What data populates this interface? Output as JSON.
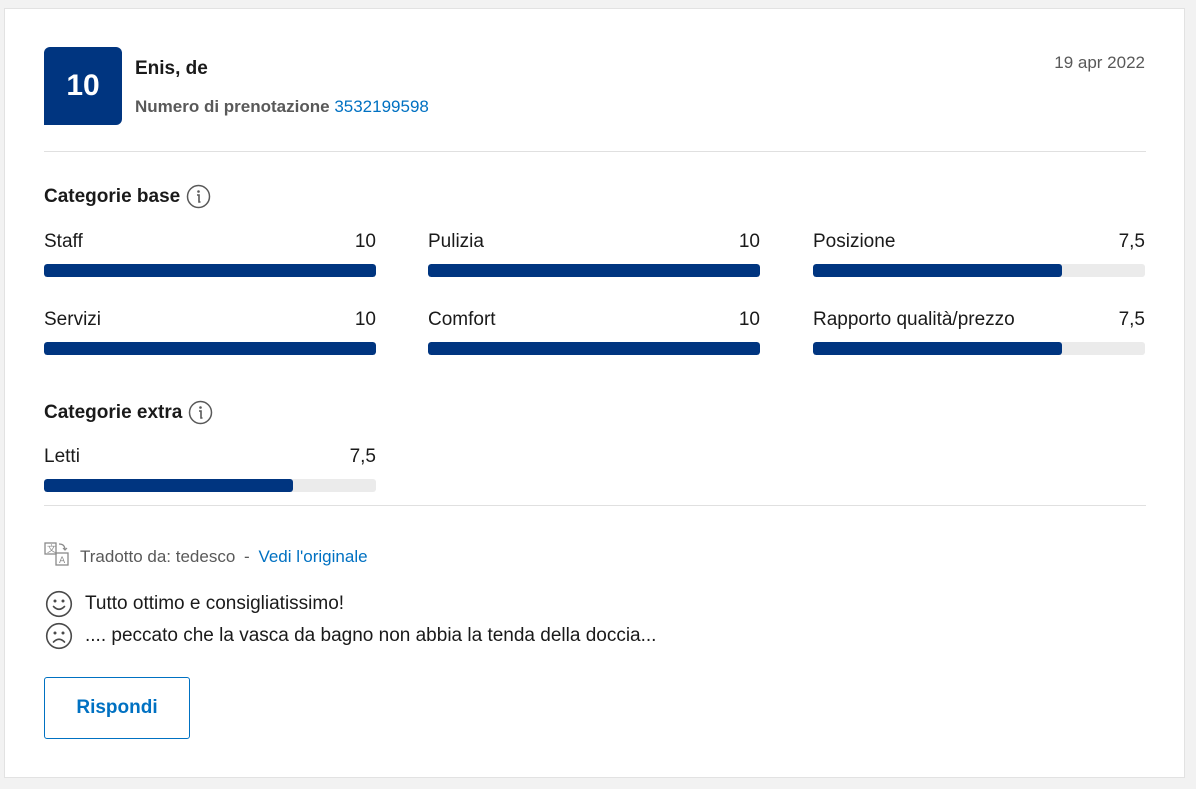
{
  "review": {
    "score": "10",
    "reviewer": "Enis, de",
    "booking_label": "Numero di prenotazione",
    "booking_number": "3532199598",
    "date": "19 apr 2022"
  },
  "base_categories": {
    "title": "Categorie base",
    "items": [
      {
        "label": "Staff",
        "score": "10",
        "fraction": 1.0
      },
      {
        "label": "Pulizia",
        "score": "10",
        "fraction": 1.0
      },
      {
        "label": "Posizione",
        "score": "7,5",
        "fraction": 0.75
      },
      {
        "label": "Servizi",
        "score": "10",
        "fraction": 1.0
      },
      {
        "label": "Comfort",
        "score": "10",
        "fraction": 1.0
      },
      {
        "label": "Rapporto qualità/prezzo",
        "score": "7,5",
        "fraction": 0.75
      }
    ]
  },
  "extra_categories": {
    "title": "Categorie extra",
    "items": [
      {
        "label": "Letti",
        "score": "7,5",
        "fraction": 0.75
      }
    ]
  },
  "translation": {
    "text": "Tradotto da: tedesco",
    "separator": "-",
    "link": "Vedi l'originale"
  },
  "comments": {
    "positive": "Tutto ottimo e consigliatissimo!",
    "negative": ".... peccato che la vasca da bagno non abbia la tenda della doccia..."
  },
  "actions": {
    "reply_label": "Rispondi"
  },
  "colors": {
    "brand_dark": "#003580",
    "link": "#0071c2"
  }
}
